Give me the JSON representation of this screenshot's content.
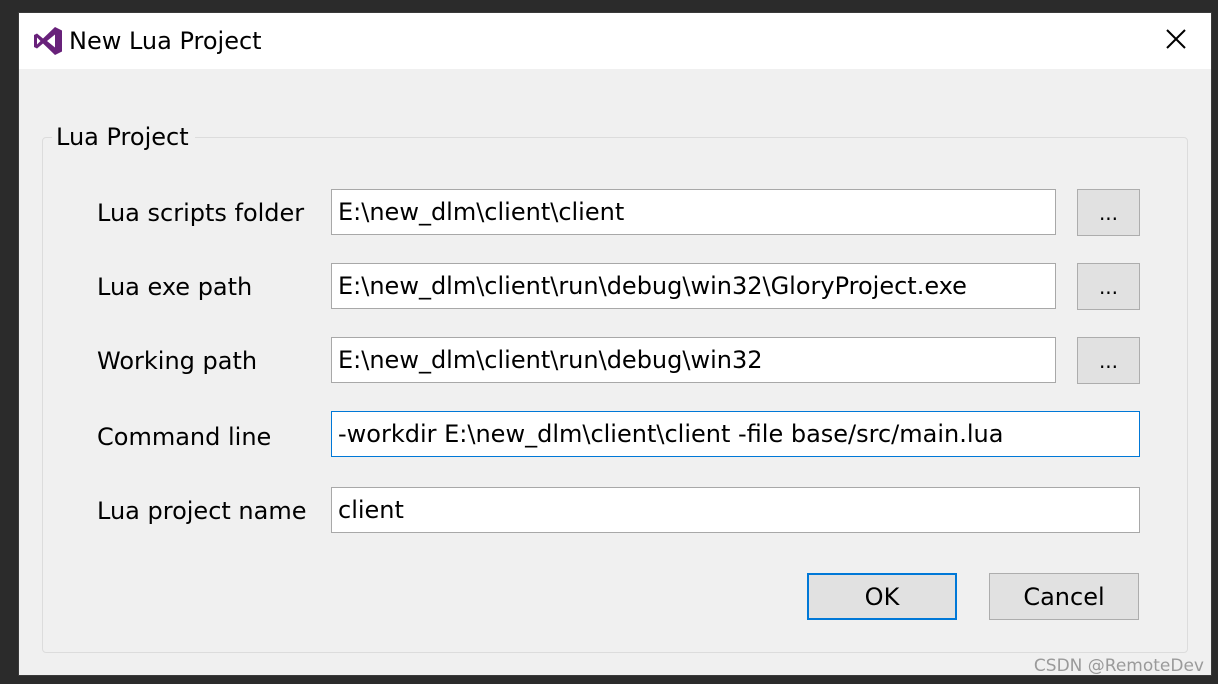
{
  "window": {
    "title": "New Lua Project",
    "app_icon": "visual-studio-icon",
    "close_icon": "close-icon"
  },
  "group": {
    "label": "Lua Project"
  },
  "fields": {
    "scripts_folder": {
      "label": "Lua scripts folder",
      "value": "E:\\new_dlm\\client\\client",
      "browse_label": "..."
    },
    "exe_path": {
      "label": "Lua exe path",
      "value": "E:\\new_dlm\\client\\run\\debug\\win32\\GloryProject.exe",
      "browse_label": "..."
    },
    "working_path": {
      "label": "Working path",
      "value": "E:\\new_dlm\\client\\run\\debug\\win32",
      "browse_label": "..."
    },
    "command_line": {
      "label": "Command line",
      "value": "-workdir E:\\new_dlm\\client\\client -file base/src/main.lua"
    },
    "project_name": {
      "label": "Lua project name",
      "value": "client"
    }
  },
  "buttons": {
    "ok": "OK",
    "cancel": "Cancel"
  },
  "colors": {
    "accent": "#0078d7",
    "icon_purple": "#68217a"
  },
  "watermark": "CSDN @RemoteDev"
}
